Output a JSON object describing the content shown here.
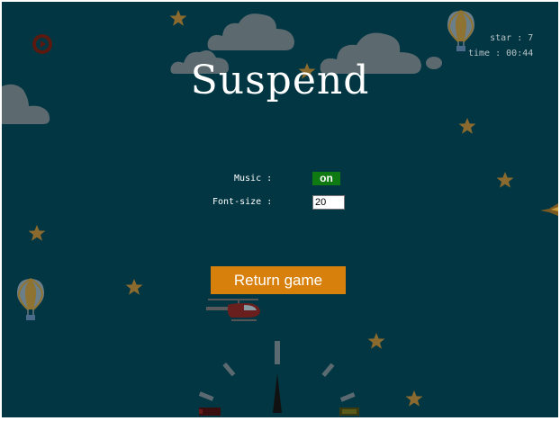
{
  "overlay": {
    "title": "Suspend",
    "return_label": "Return game"
  },
  "settings": {
    "music_label": "Music :",
    "music_value": "on",
    "font_size_label": "Font-size :",
    "font_size_value": "20"
  },
  "hud": {
    "star_label": "star",
    "star_value": "7",
    "time_label": "time",
    "time_value": "00:44"
  },
  "icons": {
    "play": "play-icon",
    "star": "star-icon",
    "balloon": "hot-air-balloon-icon",
    "helicopter": "helicopter-icon",
    "bird": "bird-icon",
    "gauge": "speed-gauge"
  },
  "colors": {
    "background": "#013642",
    "return_button": "#d8800c",
    "music_on": "#0f7a12",
    "star": "#8a6a2e",
    "cloud": "#5c6a70"
  }
}
